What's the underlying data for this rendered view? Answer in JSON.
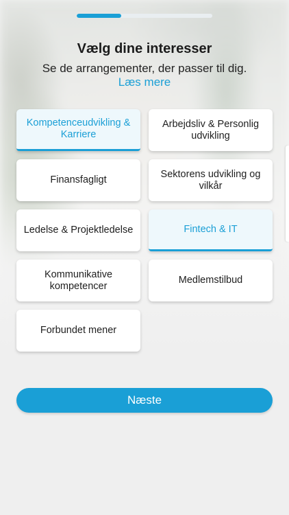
{
  "progress": {
    "fraction": 0.33
  },
  "header": {
    "title": "Vælg dine interesser",
    "subtitle": "Se de arrangementer, der passer til dig.",
    "read_more": "Læs mere"
  },
  "interests": [
    {
      "label": "Kompetenceudvikling & Karriere",
      "selected": true
    },
    {
      "label": "Arbejdsliv & Personlig udvikling",
      "selected": false
    },
    {
      "label": "Finansfagligt",
      "selected": false
    },
    {
      "label": "Sektorens udvikling og vilkår",
      "selected": false
    },
    {
      "label": "Ledelse & Projektledelse",
      "selected": false
    },
    {
      "label": "Fintech & IT",
      "selected": true
    },
    {
      "label": "Kommunikative kompetencer",
      "selected": false
    },
    {
      "label": "Medlemstilbud",
      "selected": false
    },
    {
      "label": "Forbundet mener",
      "selected": false
    }
  ],
  "footer": {
    "next_label": "Næste"
  },
  "colors": {
    "accent": "#1a9fd6",
    "selected_bg": "#eef8fc"
  }
}
